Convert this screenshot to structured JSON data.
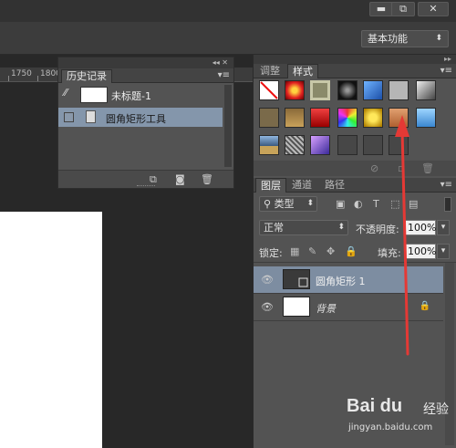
{
  "window": {
    "minimize_label": "▬",
    "restore_label": "⧉",
    "close_label": "✕"
  },
  "options_bar": {
    "workspace": "基本功能"
  },
  "ruler": {
    "ticks": [
      "1750",
      "1800"
    ]
  },
  "history_panel": {
    "collapse_label": "◂◂ ✕",
    "tab": "历史记录",
    "menu": "▾≡",
    "snapshot_label": "未标题-1",
    "entries": [
      "圆角矩形工具"
    ]
  },
  "right_dock": {
    "collapse_label": "▸▸",
    "style_tabs": [
      "调整",
      "样式"
    ],
    "active_style_tab": "样式",
    "menu": "▾≡"
  },
  "layers_panel": {
    "tabs": [
      "图层",
      "通道",
      "路径"
    ],
    "filter_kind": "类型",
    "blend_mode": "正常",
    "opacity_label": "不透明度:",
    "opacity_value": "100%",
    "lock_label": "锁定:",
    "fill_label": "填充:",
    "fill_value": "100%",
    "layers": [
      {
        "name": "圆角矩形 1",
        "selected": true
      },
      {
        "name": "背景",
        "selected": false,
        "locked": true
      }
    ]
  },
  "watermark": {
    "logo": "Bai du",
    "suffix": "经验",
    "url": "jingyan.baidu.com"
  },
  "colors": {
    "annotation_arrow": "#e53935",
    "selection": "#7d8da1"
  }
}
